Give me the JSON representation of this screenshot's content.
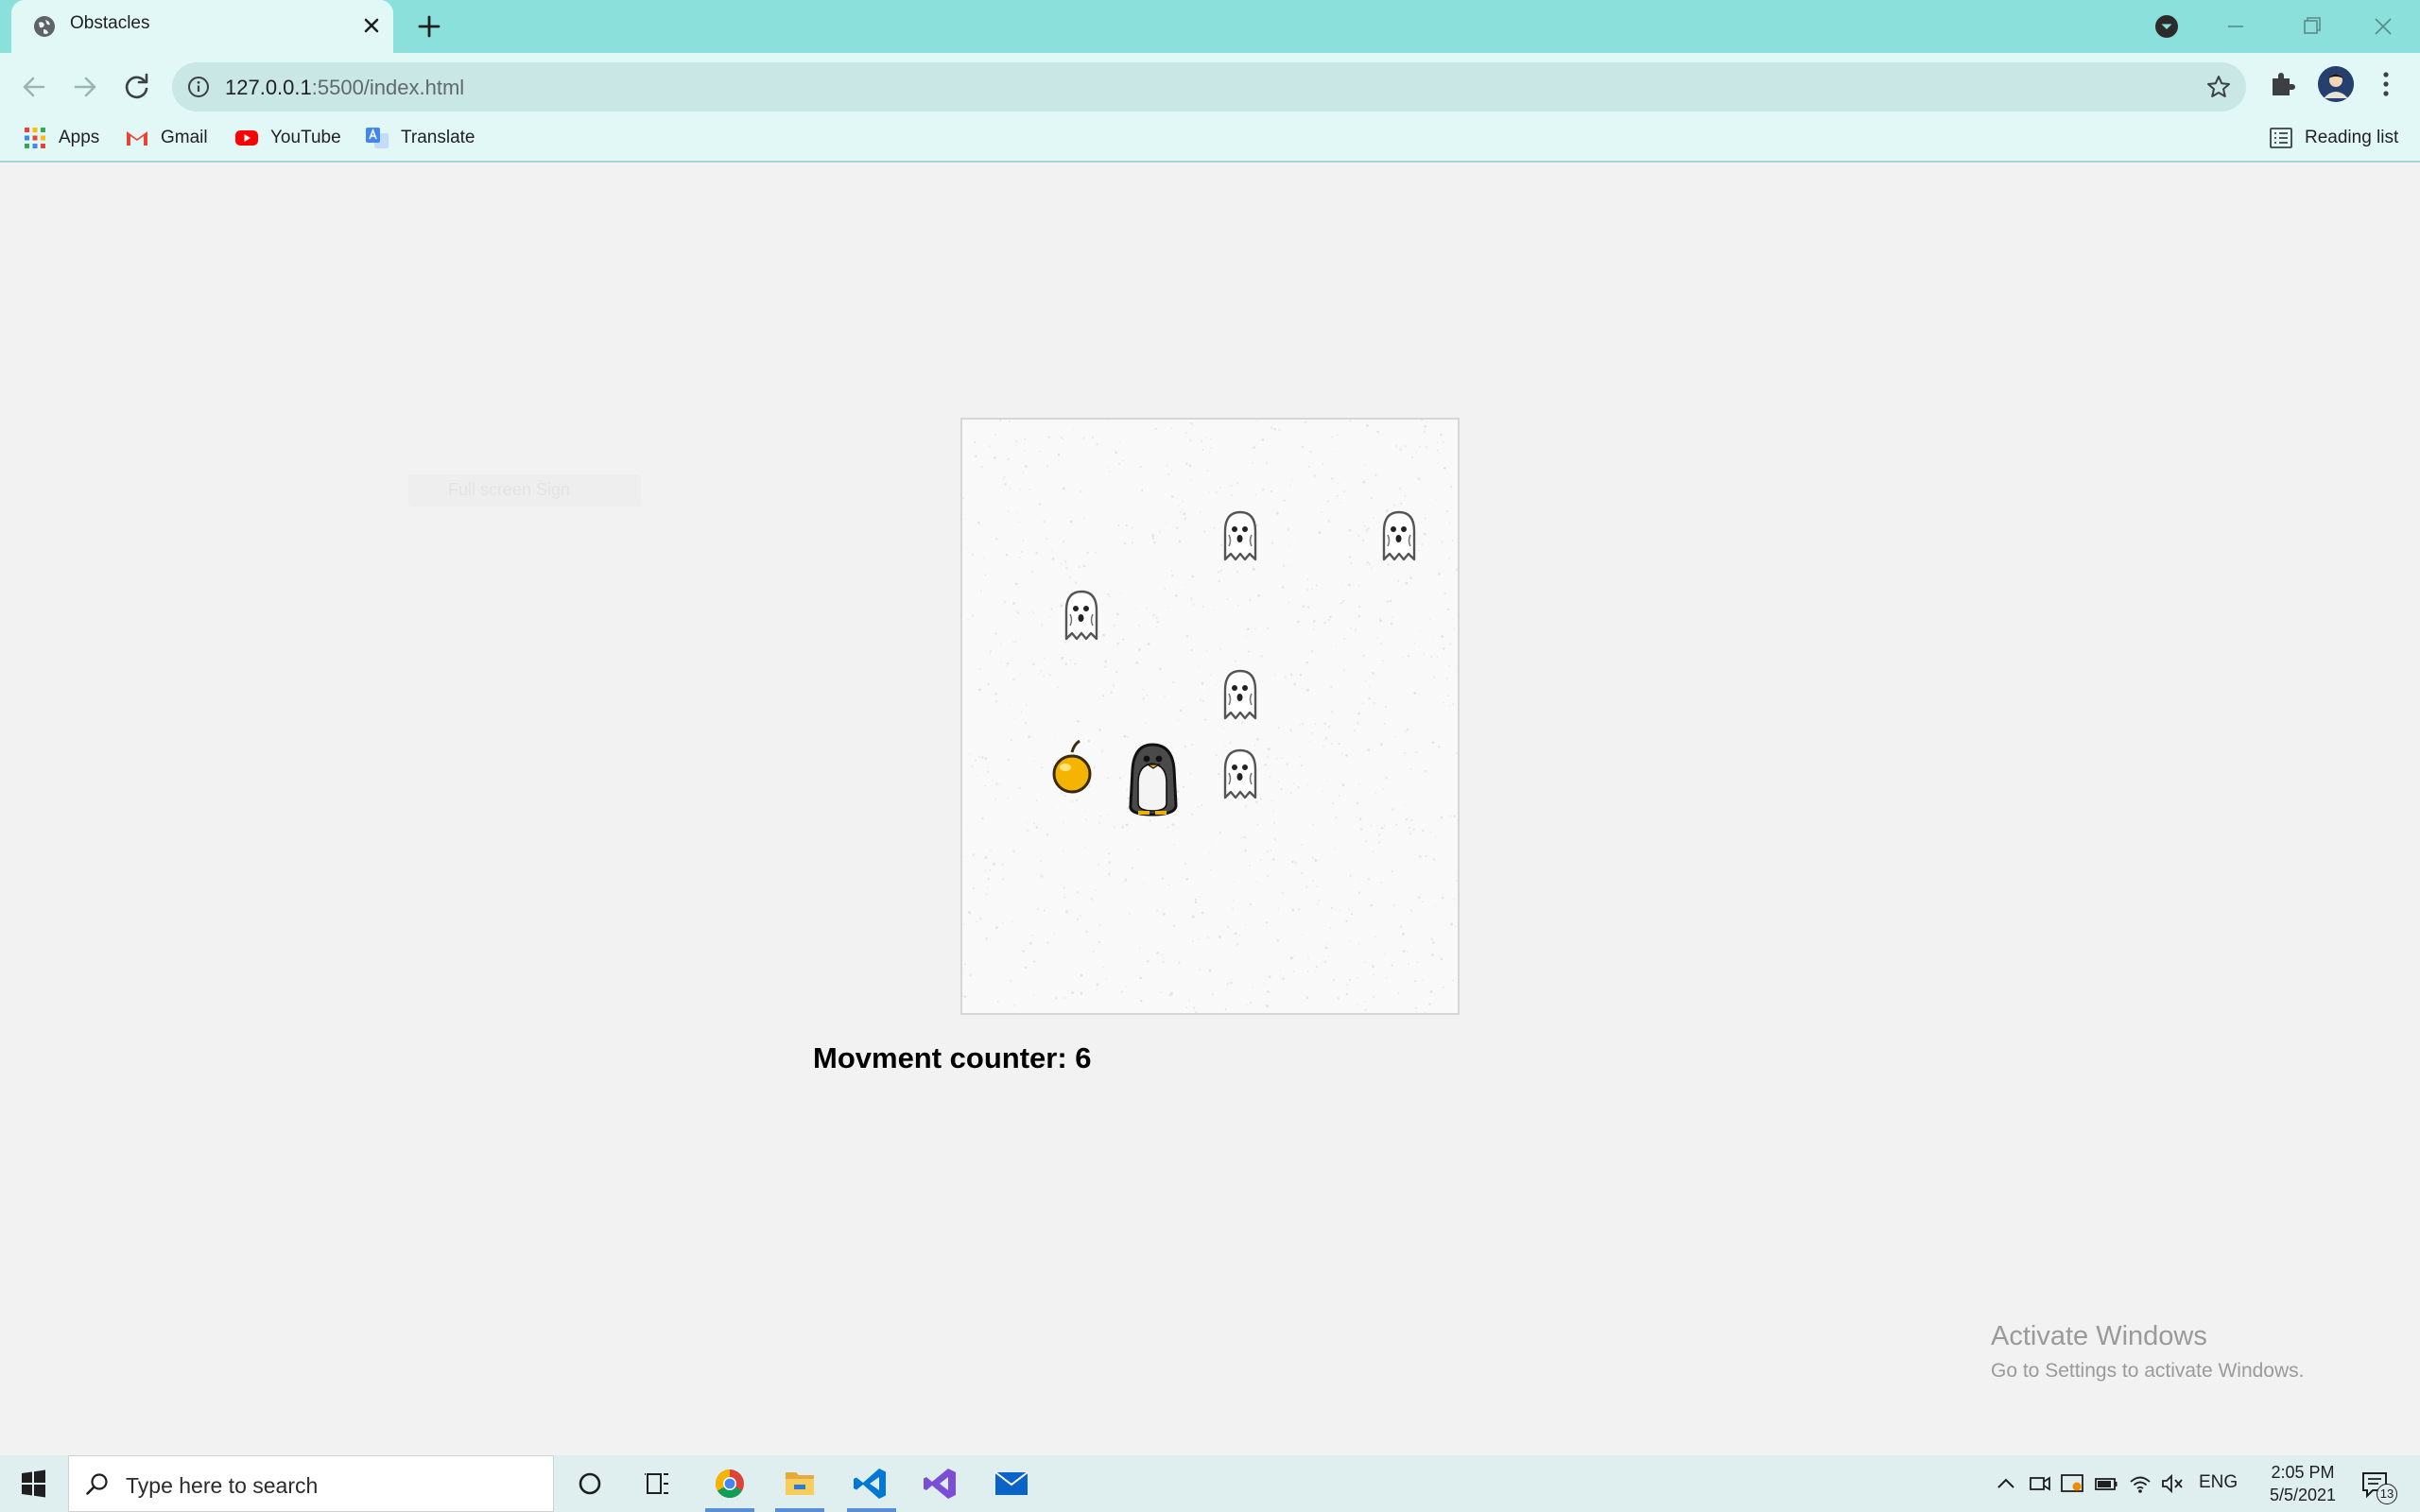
{
  "browser": {
    "tab": {
      "title": "Obstacles"
    },
    "address": {
      "host": "127.0.0.1",
      "path": ":5500/index.html"
    },
    "bookmarks": [
      {
        "label": "Apps"
      },
      {
        "label": "Gmail"
      },
      {
        "label": "YouTube"
      },
      {
        "label": "Translate"
      }
    ],
    "reading_list": "Reading list"
  },
  "page": {
    "hint_text": "Full screen Sign",
    "counter": {
      "label": "Movment counter: ",
      "value": "6"
    }
  },
  "watermark": {
    "title": "Activate Windows",
    "subtitle": "Go to Settings to activate Windows."
  },
  "taskbar": {
    "search_placeholder": "Type here to search",
    "language": "ENG",
    "time": "2:05 PM",
    "date": "5/5/2021",
    "notification_count": "13"
  },
  "colors": {
    "tab_strip": "#8be0dc",
    "toolbar": "#e2f8f7",
    "board": "#f9f9f9",
    "apple": "#f5b400"
  }
}
